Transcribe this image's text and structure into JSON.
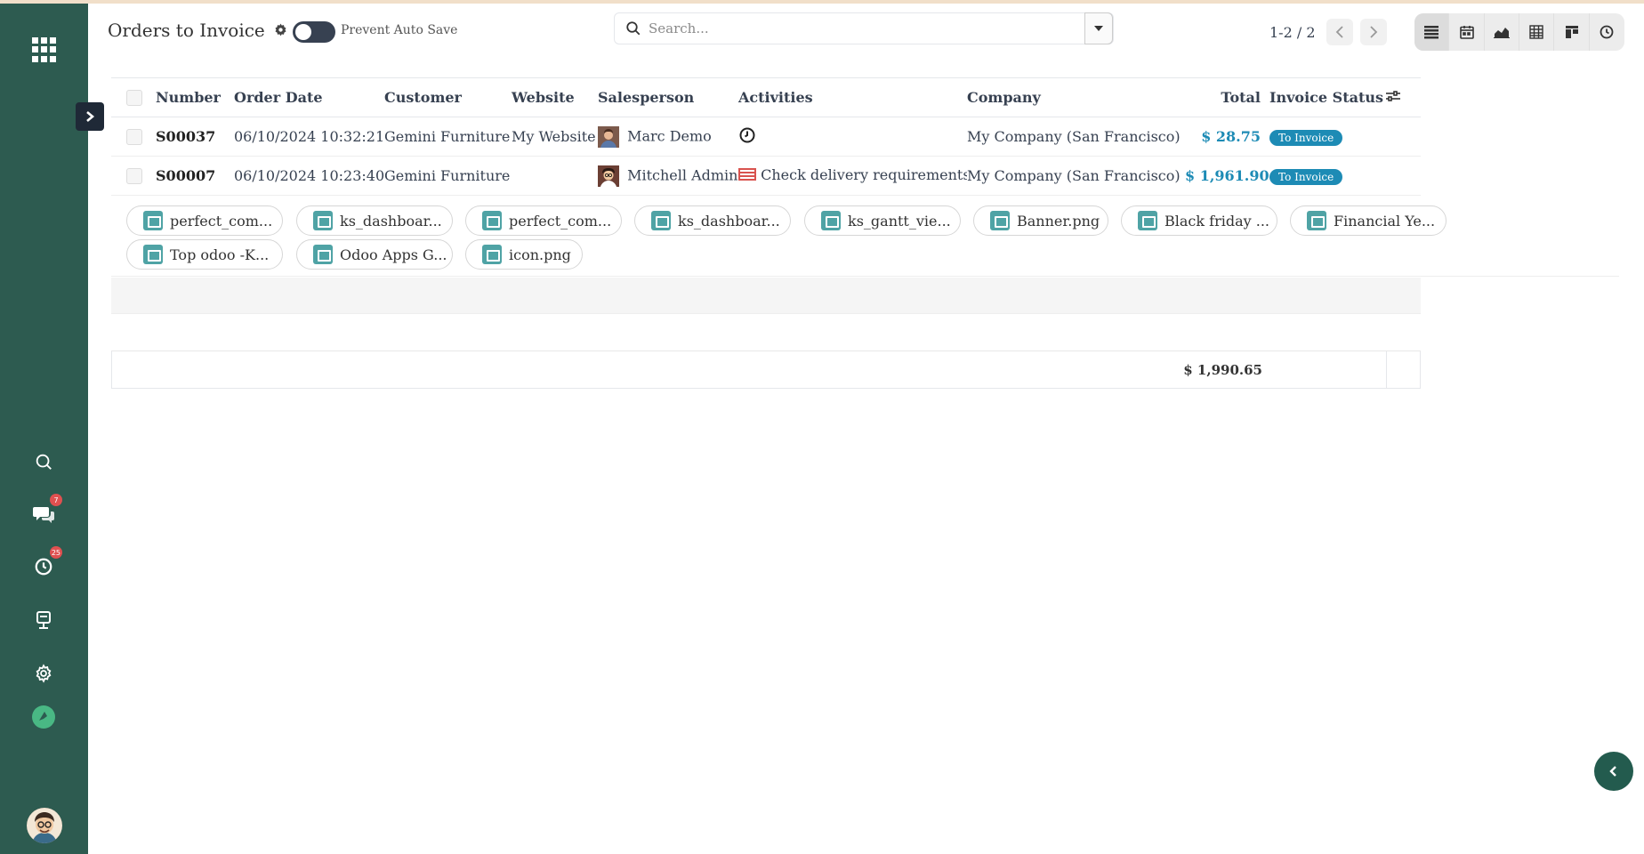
{
  "header": {
    "title": "Orders to Invoice",
    "auto_save_label": "Prevent Auto Save",
    "search_placeholder": "Search...",
    "pager": "1-2 / 2"
  },
  "sidebar": {
    "discuss_badge": "7",
    "activity_badge": "25"
  },
  "table": {
    "columns": [
      "Number",
      "Order Date",
      "Customer",
      "Website",
      "Salesperson",
      "Activities",
      "Company",
      "Total",
      "Invoice Status"
    ],
    "rows": [
      {
        "number": "S00037",
        "order_date": "06/10/2024 10:32:21",
        "customer": "Gemini Furniture",
        "website": "My Website",
        "salesperson": "Marc Demo",
        "activity": "",
        "company": "My Company (San Francisco)",
        "total": "$ 28.75",
        "status": "To Invoice"
      },
      {
        "number": "S00007",
        "order_date": "06/10/2024 10:23:40",
        "customer": "Gemini Furniture",
        "website": "",
        "salesperson": "Mitchell Admin",
        "activity": "Check delivery requirements",
        "company": "My Company (San Francisco)",
        "total": "$ 1,961.90",
        "status": "To Invoice"
      }
    ],
    "grand_total": "$ 1,990.65"
  },
  "attachments": [
    "perfect_com...",
    "ks_dashboar...",
    "perfect_com...",
    "ks_dashboar...",
    "ks_gantt_vie...",
    "Banner.png",
    "Black friday ...",
    "Financial Ye...",
    "Top odoo -K...",
    "Odoo Apps G...",
    "icon.png"
  ],
  "colors": {
    "sidebar": "#2d5b50",
    "accent": "#1d8bb5"
  }
}
